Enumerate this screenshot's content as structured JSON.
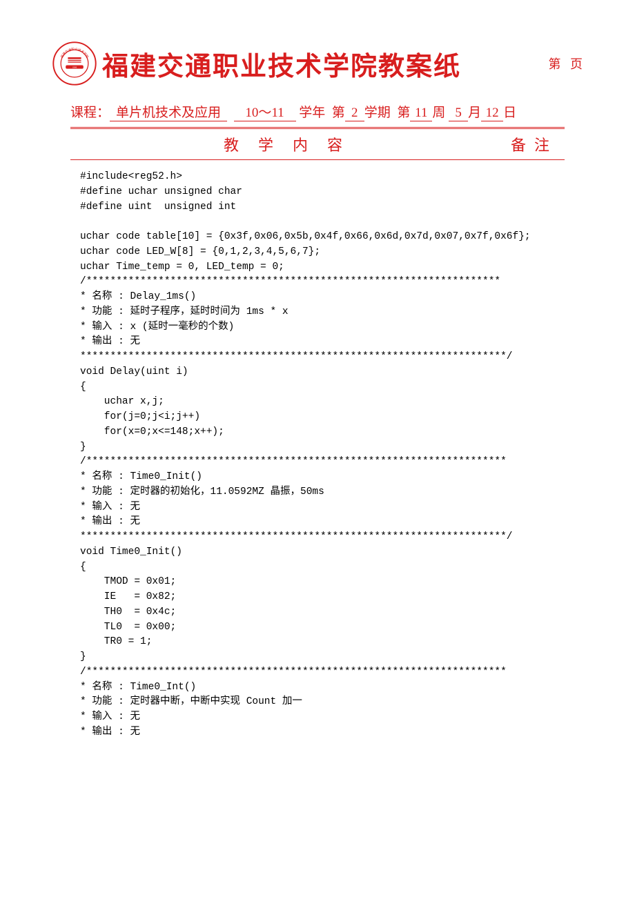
{
  "header": {
    "title": "福建交通职业技术学院教案纸",
    "page_prefix": "第",
    "page_suffix": "页",
    "course_label": "课程：",
    "course_name": "单片机技术及应用",
    "year_range": "10～11",
    "year_suffix": "学年",
    "semester_prefix": "第",
    "semester_value": "2",
    "semester_suffix": "学期",
    "week_prefix": "第",
    "week_value": "11",
    "week_suffix": "周",
    "month_value": "5",
    "month_suffix": "月",
    "day_value": "12",
    "day_suffix": "日",
    "section_teach": "教学内容",
    "section_notes": "备注"
  },
  "code": "#include<reg52.h>\n#define uchar unsigned char\n#define uint  unsigned int\n\nuchar code table[10] = {0x3f,0x06,0x5b,0x4f,0x66,0x6d,0x7d,0x07,0x7f,0x6f};\nuchar code LED_W[8] = {0,1,2,3,4,5,6,7};\nuchar Time_temp = 0, LED_temp = 0;\n/*********************************************************************\n* 名称 : Delay_1ms()\n* 功能 : 延时子程序，延时时间为 1ms * x\n* 输入 : x (延时一毫秒的个数)\n* 输出 : 无\n***********************************************************************/\nvoid Delay(uint i)\n{\n    uchar x,j;\n    for(j=0;j<i;j++)\n    for(x=0;x<=148;x++);\n}\n/**********************************************************************\n* 名称 : Time0_Init()\n* 功能 : 定时器的初始化，11.0592MZ 晶振，50ms\n* 输入 : 无\n* 输出 : 无\n***********************************************************************/\nvoid Time0_Init()\n{\n    TMOD = 0x01;\n    IE   = 0x82;\n    TH0  = 0x4c;\n    TL0  = 0x00;\n    TR0 = 1;\n}\n/**********************************************************************\n* 名称 : Time0_Int()\n* 功能 : 定时器中断，中断中实现 Count 加一\n* 输入 : 无\n* 输出 : 无"
}
